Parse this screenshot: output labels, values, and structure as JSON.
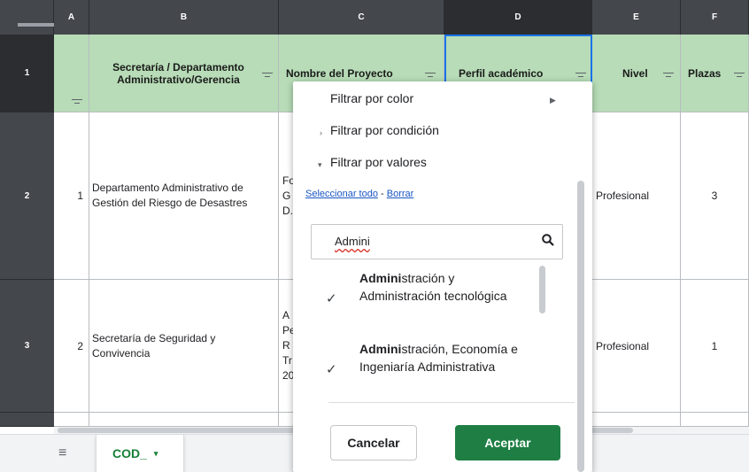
{
  "columns": [
    "A",
    "B",
    "C",
    "D",
    "E",
    "F"
  ],
  "rows": [
    "1",
    "2",
    "3"
  ],
  "headers": {
    "b": "Secretaría / Departamento Administrativo/Gerencia",
    "c": "Nombre del Proyecto",
    "d": "Perfil académico",
    "e": "Nivel",
    "f": "Plazas"
  },
  "data_rows": [
    {
      "a": "1",
      "b": "Departamento Administrativo de Gestión del Riesgo de Desastres",
      "c": "Fo\nG\nD.",
      "e": "Profesional",
      "f": "3"
    },
    {
      "a": "2",
      "b": "Secretaría de Seguridad y Convivencia",
      "c": "A\nPe\nR\nTr\n20",
      "e": "Profesional",
      "f": "1"
    }
  ],
  "filter_menu": {
    "by_color": "Filtrar por color",
    "by_condition": "Filtrar por condición",
    "by_values": "Filtrar por valores",
    "select_all": "Seleccionar todo",
    "separator": "-",
    "clear": "Borrar",
    "search_value": "Admini",
    "options": [
      {
        "bold": "Admini",
        "rest": "stración y Administración tecnológica",
        "checked": "✓"
      },
      {
        "bold": "Admini",
        "rest": "stración, Economía e Ingeniaría Administrativa",
        "checked": "✓"
      }
    ],
    "cancel": "Cancelar",
    "accept": "Aceptar"
  },
  "sheet_tab": {
    "label": "COD_",
    "caret": "▾"
  },
  "colors": {
    "header_green": "#b7dcb7",
    "accept_green": "#1e7e44",
    "link_blue": "#1a56c4"
  }
}
